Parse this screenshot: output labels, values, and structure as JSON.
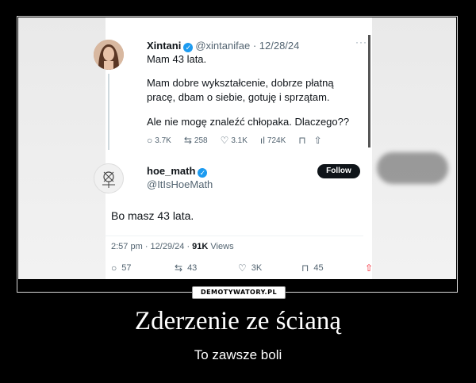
{
  "tweet": {
    "author_name": "Xintani",
    "author_handle": "@xintanifae",
    "date": "12/28/24",
    "lines": [
      "Mam 43 lata.",
      "Mam dobre wykształcenie, dobrze płatną",
      "pracę, dbam o siebie, gotuję i sprzątam.",
      "Ale nie mogę znaleźć chłopaka. Dlaczego??"
    ],
    "stats": {
      "replies": "3.7K",
      "reposts": "258",
      "likes": "3.1K",
      "views": "724K"
    }
  },
  "reply": {
    "author_name": "hoe_math",
    "author_handle": "@ItIsHoeMath",
    "follow_label": "Follow",
    "text": "Bo masz 43 lata.",
    "time": "2:57 pm",
    "date": "12/29/24",
    "views_count": "91K",
    "views_label": "Views",
    "stats": {
      "replies": "57",
      "reposts": "43",
      "likes": "3K",
      "bookmarks": "45"
    }
  },
  "watermark": "DEMOTYWATORY.PL",
  "caption": {
    "title": "Zderzenie ze ścianą",
    "subtitle": "To zawsze boli"
  },
  "icons": [
    "verified-badge-icon",
    "reply-icon",
    "repost-icon",
    "like-icon",
    "views-icon",
    "bookmark-icon",
    "share-icon",
    "more-icon"
  ],
  "colors": {
    "accent": "#1d9bf0",
    "background": "#000000",
    "text_muted": "#536471"
  }
}
